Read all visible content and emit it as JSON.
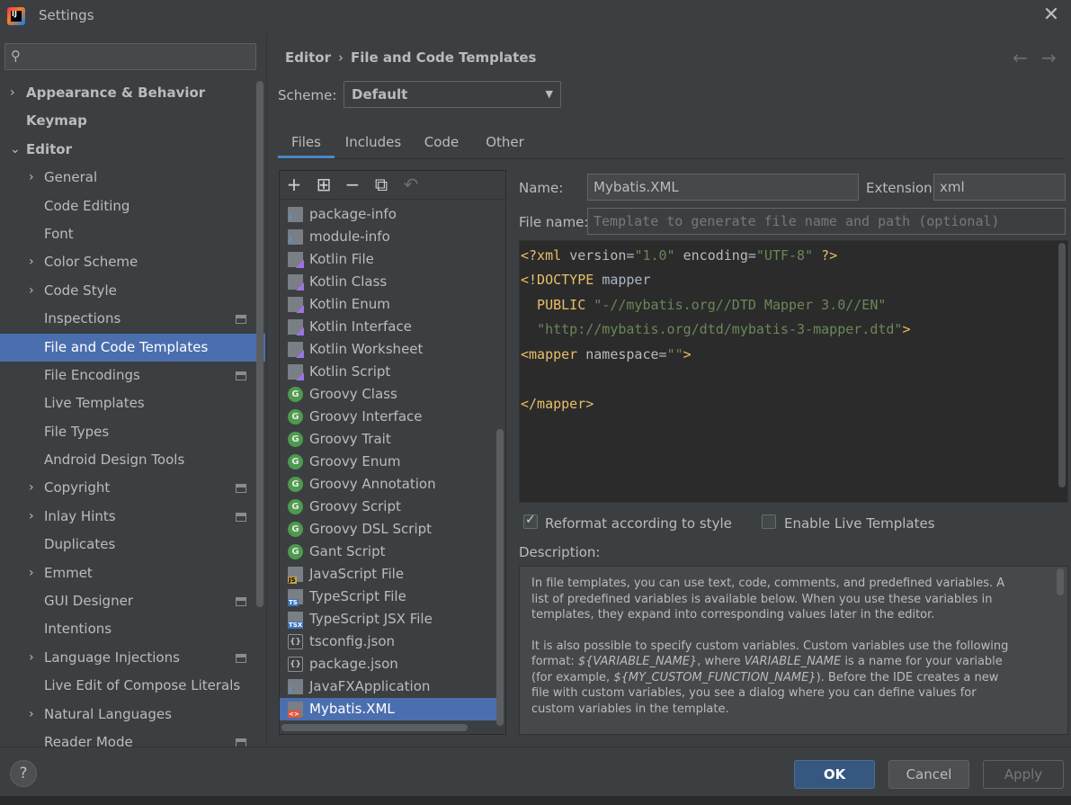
{
  "window": {
    "title": "Settings",
    "app_icon": "intellij-idea-icon",
    "close_icon": "close-icon"
  },
  "sidebar": {
    "search": {
      "placeholder": "",
      "value": ""
    },
    "items": [
      {
        "label": "Appearance & Behavior",
        "level": "top",
        "chevron": "›",
        "proj": false
      },
      {
        "label": "Keymap",
        "level": "top",
        "chevron": "",
        "proj": false
      },
      {
        "label": "Editor",
        "level": "top",
        "chevron": "⌄",
        "proj": false
      },
      {
        "label": "General",
        "level": "sub",
        "chevron": "›",
        "proj": false
      },
      {
        "label": "Code Editing",
        "level": "sub",
        "chevron": "",
        "proj": false
      },
      {
        "label": "Font",
        "level": "sub",
        "chevron": "",
        "proj": false
      },
      {
        "label": "Color Scheme",
        "level": "sub",
        "chevron": "›",
        "proj": false
      },
      {
        "label": "Code Style",
        "level": "sub",
        "chevron": "›",
        "proj": false
      },
      {
        "label": "Inspections",
        "level": "sub",
        "chevron": "",
        "proj": true
      },
      {
        "label": "File and Code Templates",
        "level": "sub",
        "chevron": "",
        "proj": false,
        "selected": true
      },
      {
        "label": "File Encodings",
        "level": "sub",
        "chevron": "",
        "proj": true
      },
      {
        "label": "Live Templates",
        "level": "sub",
        "chevron": "",
        "proj": false
      },
      {
        "label": "File Types",
        "level": "sub",
        "chevron": "",
        "proj": false
      },
      {
        "label": "Android Design Tools",
        "level": "sub",
        "chevron": "",
        "proj": false
      },
      {
        "label": "Copyright",
        "level": "sub",
        "chevron": "›",
        "proj": true
      },
      {
        "label": "Inlay Hints",
        "level": "sub",
        "chevron": "›",
        "proj": true
      },
      {
        "label": "Duplicates",
        "level": "sub",
        "chevron": "",
        "proj": false
      },
      {
        "label": "Emmet",
        "level": "sub",
        "chevron": "›",
        "proj": false
      },
      {
        "label": "GUI Designer",
        "level": "sub",
        "chevron": "",
        "proj": true
      },
      {
        "label": "Intentions",
        "level": "sub",
        "chevron": "",
        "proj": false
      },
      {
        "label": "Language Injections",
        "level": "sub",
        "chevron": "›",
        "proj": true
      },
      {
        "label": "Live Edit of Compose Literals",
        "level": "sub",
        "chevron": "",
        "proj": false
      },
      {
        "label": "Natural Languages",
        "level": "sub",
        "chevron": "›",
        "proj": false
      },
      {
        "label": "Reader Mode",
        "level": "sub",
        "chevron": "",
        "proj": true
      }
    ]
  },
  "breadcrumb": {
    "parent": "Editor",
    "separator": "›",
    "current": "File and Code Templates"
  },
  "nav": {
    "back": "←",
    "forward": "→"
  },
  "scheme": {
    "label": "Scheme:",
    "value": "Default"
  },
  "tabs": [
    {
      "label": "Files",
      "active": true
    },
    {
      "label": "Includes",
      "active": false
    },
    {
      "label": "Code",
      "active": false
    },
    {
      "label": "Other",
      "active": false
    }
  ],
  "toolbar": {
    "add": "+",
    "add_child": "⊞",
    "remove": "−",
    "copy": "⧉",
    "reset": "↶"
  },
  "templates": [
    {
      "label": "package-info",
      "icon": "java"
    },
    {
      "label": "module-info",
      "icon": "java"
    },
    {
      "label": "Kotlin File",
      "icon": "kotlin"
    },
    {
      "label": "Kotlin Class",
      "icon": "kotlin"
    },
    {
      "label": "Kotlin Enum",
      "icon": "kotlin"
    },
    {
      "label": "Kotlin Interface",
      "icon": "kotlin"
    },
    {
      "label": "Kotlin Worksheet",
      "icon": "kotlin"
    },
    {
      "label": "Kotlin Script",
      "icon": "kotlin"
    },
    {
      "label": "Groovy Class",
      "icon": "groovy"
    },
    {
      "label": "Groovy Interface",
      "icon": "groovy"
    },
    {
      "label": "Groovy Trait",
      "icon": "groovy"
    },
    {
      "label": "Groovy Enum",
      "icon": "groovy"
    },
    {
      "label": "Groovy Annotation",
      "icon": "groovy"
    },
    {
      "label": "Groovy Script",
      "icon": "groovy"
    },
    {
      "label": "Groovy DSL Script",
      "icon": "groovy"
    },
    {
      "label": "Gant Script",
      "icon": "groovy"
    },
    {
      "label": "JavaScript File",
      "icon": "js"
    },
    {
      "label": "TypeScript File",
      "icon": "ts"
    },
    {
      "label": "TypeScript JSX File",
      "icon": "tsx"
    },
    {
      "label": "tsconfig.json",
      "icon": "json"
    },
    {
      "label": "package.json",
      "icon": "json"
    },
    {
      "label": "JavaFXApplication",
      "icon": "fx"
    },
    {
      "label": "Mybatis.XML",
      "icon": "xml",
      "selected": true
    }
  ],
  "form": {
    "name_label": "Name:",
    "name_value": "Mybatis.XML",
    "ext_label": "Extension:",
    "ext_value": "xml",
    "filename_label": "File name:",
    "filename_placeholder": "Template to generate file name and path (optional)"
  },
  "code": {
    "l1_a": "<?xml ",
    "l1_b": "version",
    "l1_c": "=",
    "l1_d": "\"1.0\"",
    "l1_e": " encoding",
    "l1_f": "=",
    "l1_g": "\"UTF-8\"",
    "l1_h": " ?>",
    "l2_a": "<!DOCTYPE ",
    "l2_b": "mapper",
    "l3_a": "  PUBLIC ",
    "l3_b": "\"-//mybatis.org//DTD Mapper 3.0//EN\"",
    "l4_a": "  ",
    "l4_b": "\"http://mybatis.org/dtd/mybatis-3-mapper.dtd\"",
    "l4_c": ">",
    "l5_a": "<mapper ",
    "l5_b": "namespace",
    "l5_c": "=",
    "l5_d": "\"\"",
    "l5_e": ">",
    "l7_a": "</mapper>"
  },
  "options": {
    "reformat_label": "Reformat according to style",
    "reformat_checked": true,
    "live_label": "Enable Live Templates",
    "live_checked": false
  },
  "description": {
    "label": "Description:",
    "p1": "In file templates, you can use text, code, comments, and predefined variables. A list of predefined variables is available below. When you use these variables in templates, they expand into corresponding values later in the editor.",
    "p2_a": "It is also possible to specify custom variables. Custom variables use the following format: ",
    "p2_b": "${VARIABLE_NAME}",
    "p2_c": ", where ",
    "p2_d": "VARIABLE_NAME",
    "p2_e": " is a name for your variable (for example, ",
    "p2_f": "${MY_CUSTOM_FUNCTION_NAME}",
    "p2_g": "). Before the IDE creates a new file with custom variables, you see a dialog where you can define values for custom variables in the template."
  },
  "footer": {
    "help": "?",
    "ok": "OK",
    "cancel": "Cancel",
    "apply": "Apply"
  },
  "colors": {
    "accent": "#4b6eaf",
    "ok_button": "#365880",
    "tag": "#e8bf6a",
    "string": "#6a8759"
  }
}
